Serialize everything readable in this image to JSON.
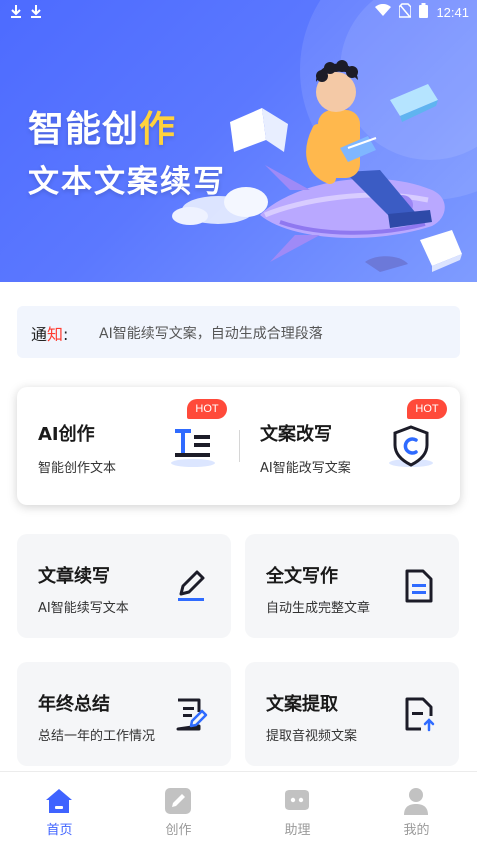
{
  "status_bar": {
    "time": "12:41"
  },
  "banner": {
    "title_part1": "智能创",
    "title_highlight": "作",
    "subtitle": "文本文案续写"
  },
  "notice": {
    "tag_part1": "通",
    "tag_part2": "知",
    "tag_colon": ":",
    "message": "AI智能续写文案，自动生成合理段落"
  },
  "hot_features": [
    {
      "title": "AI创作",
      "desc": "智能创作文本",
      "badge": "HOT",
      "icon": "text-align-icon"
    },
    {
      "title": "文案改写",
      "desc": "AI智能改写文案",
      "badge": "HOT",
      "icon": "shield-c-icon"
    }
  ],
  "features": [
    {
      "title": "文章续写",
      "desc": "AI智能续写文本",
      "icon": "pen-edit-icon"
    },
    {
      "title": "全文写作",
      "desc": "自动生成完整文章",
      "icon": "document-icon"
    },
    {
      "title": "年终总结",
      "desc": "总结一年的工作情况",
      "icon": "note-edit-icon"
    },
    {
      "title": "文案提取",
      "desc": "提取音视频文案",
      "icon": "file-upload-icon"
    }
  ],
  "tabs": [
    {
      "label": "首页",
      "icon": "home-icon",
      "active": true
    },
    {
      "label": "创作",
      "icon": "edit-icon",
      "active": false
    },
    {
      "label": "助理",
      "icon": "chat-bot-icon",
      "active": false
    },
    {
      "label": "我的",
      "icon": "user-icon",
      "active": false
    }
  ],
  "colors": {
    "accent": "#3f63ff",
    "hot_badge": "#ff4a3a",
    "banner_start": "#4d6bff",
    "banner_end": "#7f9cff",
    "highlight": "#ffd23d"
  }
}
